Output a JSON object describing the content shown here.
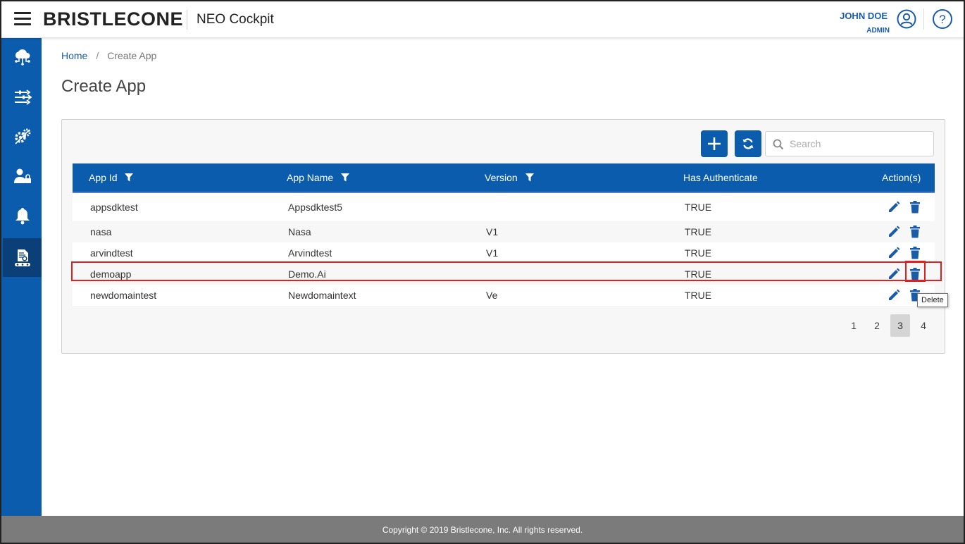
{
  "header": {
    "brand": "BRISTLECONE",
    "app_name": "NEO Cockpit",
    "user_name": "JOHN DOE",
    "user_role": "ADMIN"
  },
  "sidebar": {
    "items": [
      {
        "icon": "cloud-network-icon"
      },
      {
        "icon": "sliders-icon"
      },
      {
        "icon": "gears-icon"
      },
      {
        "icon": "user-lock-icon"
      },
      {
        "icon": "bell-icon"
      },
      {
        "icon": "app-builder-icon",
        "active": true
      }
    ]
  },
  "breadcrumb": {
    "home": "Home",
    "separator": "/",
    "current": "Create App"
  },
  "page": {
    "title": "Create App"
  },
  "toolbar": {
    "search_placeholder": "Search",
    "add_icon": "plus-icon",
    "refresh_icon": "refresh-icon"
  },
  "table": {
    "columns": [
      "App Id",
      "App Name",
      "Version",
      "Has Authenticate",
      "Action(s)"
    ],
    "rows": [
      {
        "app_id": "appsdktest",
        "app_name": "Appsdktest5",
        "version": "",
        "has_auth": "TRUE"
      },
      {
        "app_id": "nasa",
        "app_name": "Nasa",
        "version": "V1",
        "has_auth": "TRUE"
      },
      {
        "app_id": "arvindtest",
        "app_name": "Arvindtest",
        "version": "V1",
        "has_auth": "TRUE"
      },
      {
        "app_id": "demoapp",
        "app_name": "Demo.Ai",
        "version": "",
        "has_auth": "TRUE"
      },
      {
        "app_id": "newdomaintest",
        "app_name": "Newdomaintext",
        "version": "Ve",
        "has_auth": "TRUE"
      }
    ]
  },
  "tooltip": "Delete",
  "pagination": {
    "pages": [
      "1",
      "2",
      "3",
      "4"
    ],
    "current": "3"
  },
  "footer": {
    "copyright": "Copyright © 2019 Bristlecone, Inc. All rights reserved."
  },
  "colors": {
    "primary": "#0b5cad",
    "sidebar_active": "#0a3f78",
    "highlight": "#e02020",
    "footer": "#7b7b7b"
  }
}
